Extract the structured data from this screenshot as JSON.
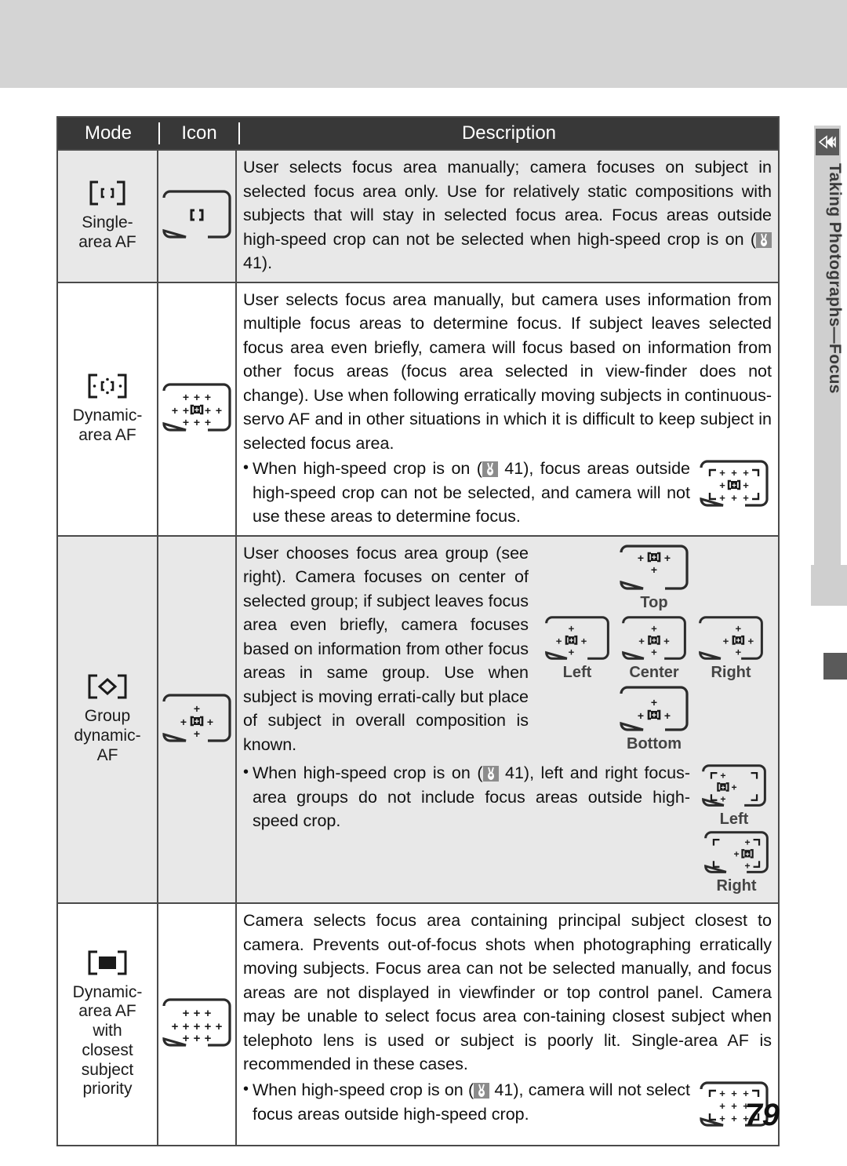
{
  "page": {
    "number": "79"
  },
  "sidebar": {
    "icon": "camera-playback-icon",
    "label": "Taking Photographs—Focus"
  },
  "table": {
    "headers": {
      "mode": "Mode",
      "icon": "Icon",
      "description": "Description"
    },
    "rows": [
      {
        "mode_glyph": "single-area-af-glyph",
        "mode_label": "Single-\narea AF",
        "mode_label_lines": [
          "Single-",
          "area AF"
        ],
        "icon_diagram": "viewfinder-single-point",
        "paragraphs": [
          "User selects focus area manually; camera focuses on subject in selected focus area only.  Use for relatively static compositions with subjects that will stay in selected focus area.  Focus areas outside high-speed crop can not be selected when high-speed crop is on (",
          " 41)."
        ],
        "ref_page": "41",
        "bullets": []
      },
      {
        "mode_glyph": "dynamic-area-af-glyph",
        "mode_label_lines": [
          "Dynamic-",
          "area AF"
        ],
        "icon_diagram": "viewfinder-eleven-points-center-selected",
        "paragraph_main": "User selects focus area manually, but camera uses information from multiple focus areas to determine focus.  If subject leaves selected focus area even briefly, camera will focus based on information from other focus areas (focus area selected in view-finder does not change).  Use when following erratically moving subjects in continuous-servo AF and in other situations in which it is difficult to keep subject in selected focus area.",
        "bullet_pre": "When high-speed crop is on (",
        "bullet_post": " 41), focus areas outside high-speed crop can not be selected, and camera will not use these areas to determine focus.",
        "ref_page": "41",
        "crop_diagram": "viewfinder-crop-eleven-points"
      },
      {
        "mode_glyph": "group-dynamic-af-glyph",
        "mode_label_lines": [
          "Group",
          "dynamic-",
          "AF"
        ],
        "icon_diagram": "viewfinder-group-center",
        "paragraph_main": "User chooses focus area group (see right).  Camera focuses on center of selected group; if subject leaves focus area even briefly, camera focuses based on information from other focus areas in same group.  Use when subject is moving errati-cally but place of subject in overall composition is known.",
        "bullet_pre": "When high-speed crop is on (",
        "bullet_post": " 41), left and right focus-area groups do not include focus areas outside high-speed crop.",
        "ref_page": "41",
        "group_figures": [
          {
            "name": "group-top",
            "caption": "Top"
          },
          {
            "name": "group-left",
            "caption": "Left"
          },
          {
            "name": "group-center",
            "caption": "Center"
          },
          {
            "name": "group-right",
            "caption": "Right"
          },
          {
            "name": "group-bottom",
            "caption": "Bottom"
          }
        ],
        "crop_figures": [
          {
            "name": "crop-group-left",
            "caption": "Left"
          },
          {
            "name": "crop-group-right",
            "caption": "Right"
          }
        ]
      },
      {
        "mode_glyph": "closest-subject-priority-glyph",
        "mode_label_lines": [
          "Dynamic-",
          "area AF",
          "with",
          "closest",
          "subject",
          "priority"
        ],
        "icon_diagram": "viewfinder-eleven-points-plain",
        "paragraph_main": "Camera selects focus area containing principal subject closest to camera.  Prevents out-of-focus shots when photographing erratically moving subjects.  Focus area can not be selected manually, and focus areas are not displayed in viewfinder or top control panel.  Camera may be unable to select focus area con-taining closest subject when telephoto lens is used or subject is poorly lit.  Single-area AF is recommended in these cases.",
        "bullet_pre": "When high-speed crop is on (",
        "bullet_post": " 41), camera will not select focus areas outside high-speed crop.",
        "ref_page": "41",
        "crop_diagram": "viewfinder-crop-eleven-points-plain"
      }
    ]
  },
  "colors": {
    "header_bg": "#383838",
    "shade_bg": "#e8e8e8",
    "rail_bg": "#cfcfcf",
    "ink": "#1a1a1a"
  }
}
